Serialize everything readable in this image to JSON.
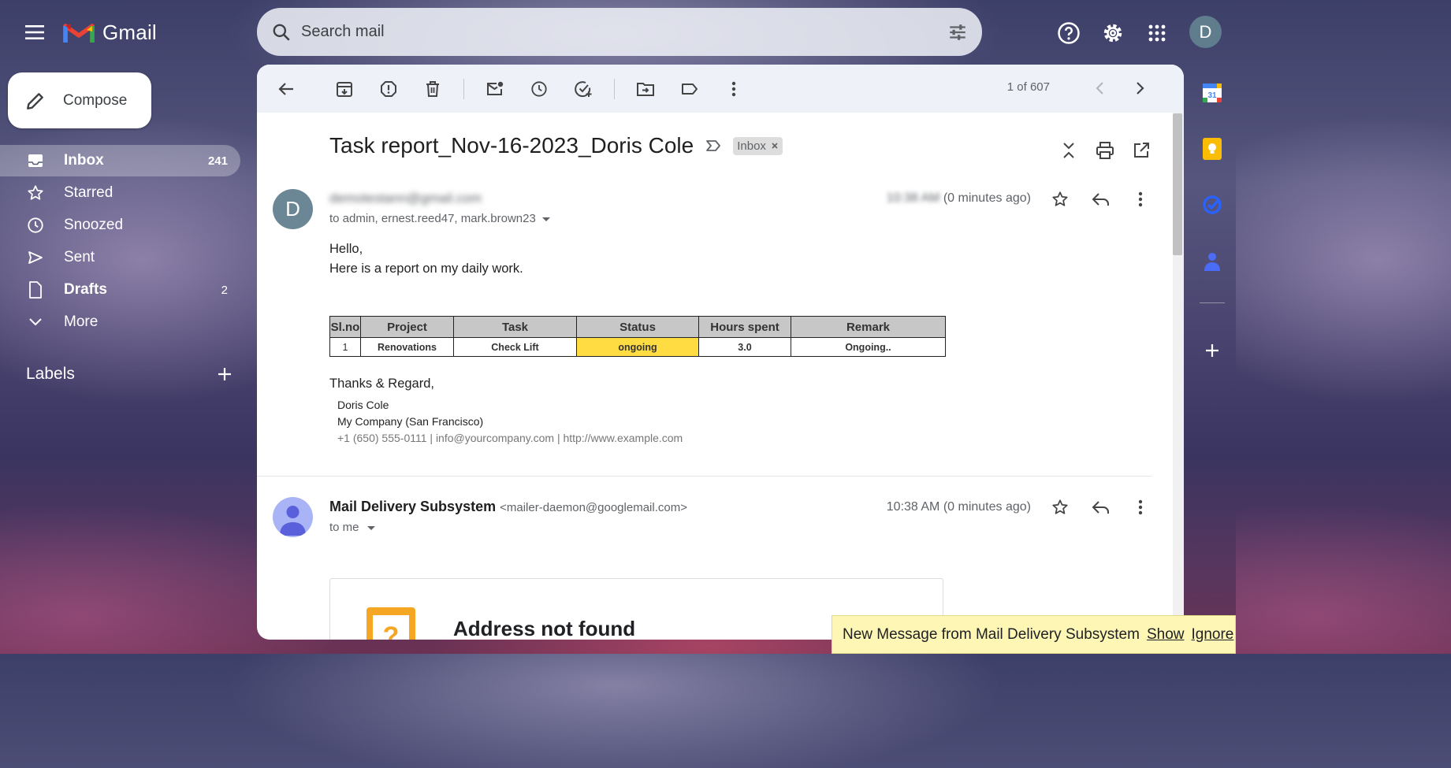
{
  "colors": {
    "accent": "#1a73e8",
    "status_highlight": "#ffdc42",
    "toast_bg": "#fdf6b5"
  },
  "header": {
    "app_name": "Gmail",
    "search_placeholder": "Search mail",
    "avatar_letter": "D",
    "icons": [
      "menu-icon",
      "search-icon",
      "tune-icon",
      "help-icon",
      "settings-icon",
      "apps-icon"
    ]
  },
  "sidebar": {
    "compose_label": "Compose",
    "items": [
      {
        "label": "Inbox",
        "count": "241",
        "icon": "inbox-icon"
      },
      {
        "label": "Starred",
        "count": "",
        "icon": "star-icon"
      },
      {
        "label": "Snoozed",
        "count": "",
        "icon": "clock-icon"
      },
      {
        "label": "Sent",
        "count": "",
        "icon": "send-icon"
      },
      {
        "label": "Drafts",
        "count": "2",
        "icon": "draft-icon"
      },
      {
        "label": "More",
        "count": "",
        "icon": "chevron-down-icon"
      }
    ],
    "labels_title": "Labels"
  },
  "toolbar": {
    "pager_text": "1 of 607",
    "icons": [
      "back-icon",
      "archive-icon",
      "report-spam-icon",
      "delete-icon",
      "mark-unread-icon",
      "snooze-icon",
      "add-task-icon",
      "move-to-icon",
      "label-icon",
      "more-icon",
      "prev-icon",
      "next-icon"
    ]
  },
  "message": {
    "subject": "Task report_Nov-16-2023_Doris Cole",
    "label_badge": "Inbox",
    "sender_letter": "D",
    "sender_email": "demotestann@gmail.com",
    "to_line": "to admin, ernest.reed47, mark.brown23",
    "time_prefix": "10:38 AM",
    "time_suffix": "(0 minutes ago)",
    "greeting": "Hello,",
    "intro": "Here is a report on my daily work.",
    "table": {
      "headers": [
        "Sl.no",
        "Project",
        "Task",
        "Status",
        "Hours spent",
        "Remark"
      ],
      "rows": [
        [
          "1",
          "Renovations",
          "Check Lift",
          "ongoing",
          "3.0",
          "Ongoing.."
        ]
      ]
    },
    "closing": "Thanks & Regard,",
    "sig_name": "Doris Cole",
    "sig_company": "My Company (San Francisco)",
    "sig_phone": "+1 (650) 555-0111 |",
    "sig_email": "info@yourcompany.com",
    "sig_sep": "|",
    "sig_url": "http://www.example.com"
  },
  "bounce": {
    "sender_name": "Mail Delivery Subsystem",
    "sender_email": "<mailer-daemon@googlemail.com>",
    "to_line": "to me",
    "time": "10:38 AM (0 minutes ago)",
    "card_title": "Address not found"
  },
  "toast": {
    "message": "New Message from Mail Delivery Subsystem",
    "show_label": "Show",
    "ignore_label": "Ignore"
  }
}
